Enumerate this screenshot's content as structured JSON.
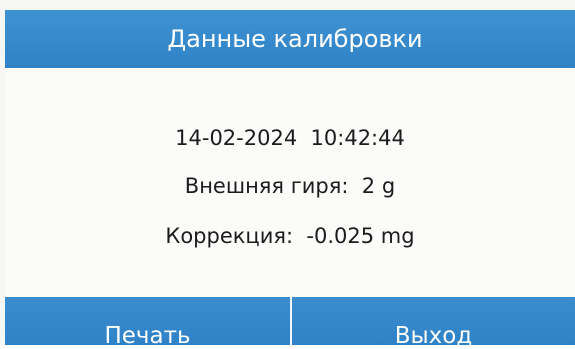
{
  "title": "Данные калибровки",
  "info": {
    "datetime": "14-02-2024  10:42:44",
    "external_weight": "Внешняя гиря:  2 g",
    "correction": "Коррекция:  -0.025 mg"
  },
  "buttons": {
    "print_label": "Печать",
    "exit_label": "Выход"
  },
  "colors": {
    "bar": "#3589cb",
    "text": "#1c1c1c",
    "background": "#fbfbfa"
  }
}
